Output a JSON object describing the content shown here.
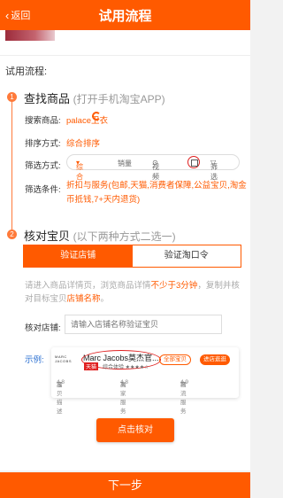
{
  "header": {
    "back_label": "返回",
    "title": "试用流程"
  },
  "section_title": "试用流程:",
  "steps": [
    {
      "num": "1",
      "title": "查找商品",
      "subtitle": "(打开手机淘宝APP)"
    },
    {
      "num": "2",
      "title": "核对宝贝",
      "subtitle": "(以下两种方式二选一)"
    }
  ],
  "search": {
    "label": "搜索商品:",
    "value": "palace卫衣"
  },
  "sort": {
    "label": "排序方式:",
    "value": "综合排序"
  },
  "filter": {
    "label": "筛选方式:",
    "items": [
      "综合",
      "销量",
      "视频",
      "筛选"
    ]
  },
  "conditions": {
    "label": "筛选条件:",
    "value": "折扣与服务(包邮,天猫,消费者保障,公益宝贝,淘金币抵钱,7+天内退货)"
  },
  "tabs": {
    "verify_shop": "验证店铺",
    "verify_taokou": "验证淘口令"
  },
  "hint": {
    "part1": "请进入商品详情页，浏览商品详情",
    "highlight1": "不少于3分钟",
    "part2": "，复制并核对目标宝贝",
    "highlight2": "店铺名称",
    "part3": "。"
  },
  "shop": {
    "label": "核对店铺:",
    "placeholder": "请输入店铺名称验证宝贝"
  },
  "example": {
    "label": "示例:",
    "logo_text": "MARC JACOBS",
    "shop_name": "Marc Jacobs莫杰官...",
    "tmall_badge": "天猫",
    "rating_text": "综合体验 ★★★★☆",
    "btn_all": "全部宝贝",
    "btn_enter": "进店逛逛",
    "stats": [
      {
        "label": "宝贝描述",
        "value": "4.8",
        "trend": "高"
      },
      {
        "label": "卖家服务",
        "value": "4.8",
        "trend": "高"
      },
      {
        "label": "物流服务",
        "value": "4.9",
        "trend": "高"
      }
    ]
  },
  "check_button": "点击核对",
  "next_button": "下一步",
  "colors": {
    "primary": "#ff5a00",
    "link": "#2a6fd1",
    "highlight_circle": "#e02020"
  }
}
